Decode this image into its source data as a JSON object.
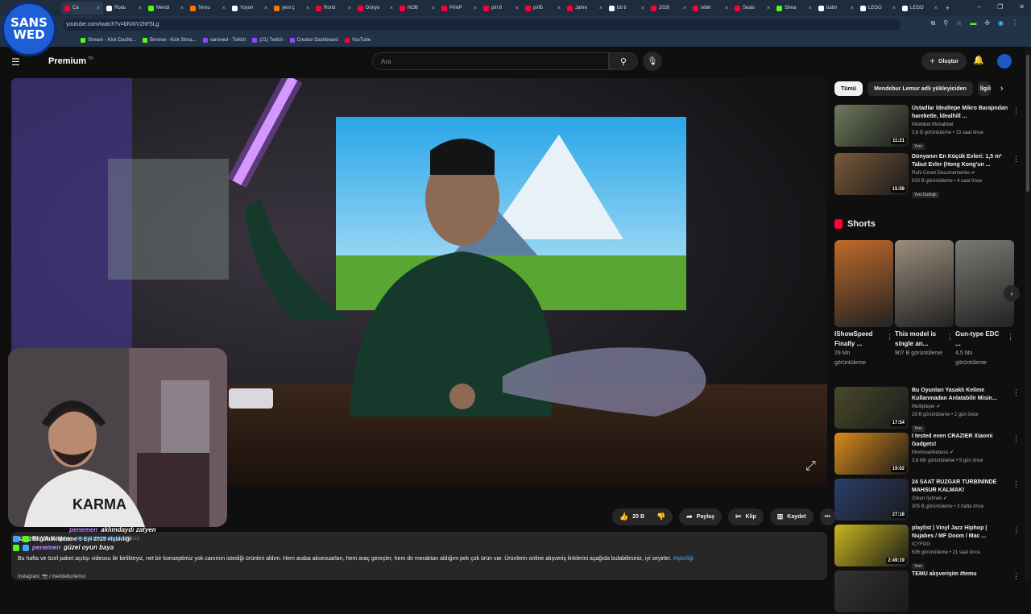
{
  "browser": {
    "tabs": [
      {
        "label": "Ca",
        "color": "#ff0033"
      },
      {
        "label": "Rodu",
        "color": "#ffffff"
      },
      {
        "label": "Mendi",
        "color": "#53fc18"
      },
      {
        "label": "Temu",
        "color": "#fb7701"
      },
      {
        "label": "Yoyon",
        "color": "#ffffff"
      },
      {
        "label": "yeni ç",
        "color": "#fb7701"
      },
      {
        "label": "Rond",
        "color": "#ff0033"
      },
      {
        "label": "Dünya",
        "color": "#ff0033"
      },
      {
        "label": "NOB",
        "color": "#ff0033"
      },
      {
        "label": "PinkP",
        "color": "#ff0033"
      },
      {
        "label": "piri 8",
        "color": "#ff0033"
      },
      {
        "label": "piriБ",
        "color": "#ff0033"
      },
      {
        "label": "Jahre",
        "color": "#ff0033"
      },
      {
        "label": "bb tr",
        "color": "#ffffff"
      },
      {
        "label": "2026",
        "color": "#ff0033"
      },
      {
        "label": "lvbel",
        "color": "#ff0033"
      },
      {
        "label": "Seals",
        "color": "#ff0033"
      },
      {
        "label": "Strea",
        "color": "#53fc18"
      },
      {
        "label": "batm",
        "color": "#ffffff"
      },
      {
        "label": "LEGO",
        "color": "#ffffff"
      },
      {
        "label": "LEGO",
        "color": "#ffffff"
      }
    ],
    "new_tab": "+",
    "window_controls": [
      "–",
      "❐",
      "✕"
    ],
    "url": "youtube.com/watch?v=bNXiV2hF5Lg",
    "bookmarks": [
      {
        "label": "Stream - Kick Dashb...",
        "color": "#53fc18"
      },
      {
        "label": "Browse - Kick Strea...",
        "color": "#53fc18"
      },
      {
        "label": "sansved - Twitch",
        "color": "#9146ff"
      },
      {
        "label": "(21) Twitch",
        "color": "#9146ff"
      },
      {
        "label": "Creator Dashboard",
        "color": "#9146ff"
      },
      {
        "label": "YouTube",
        "color": "#ff0033"
      }
    ]
  },
  "overlay_logo": {
    "line1": "SANS",
    "line2": "WED"
  },
  "header": {
    "brand": "Premium",
    "brand_suffix": "TR",
    "search_placeholder": "Ara",
    "create_label": "Oluştur"
  },
  "actions": {
    "like_count": "20 B",
    "share": "Paylaş",
    "clip": "Klip",
    "save": "Kaydet"
  },
  "description": {
    "stats": "425.293 görüntülenme  5 Eyl 2025  #işbirliği",
    "text": "Bu hafta ve özel paket açılışı videosu ile birlikteyiz, net bir konseptimiz yok canımın istediği ürünleri aldım. Hem araba aksesuarları, hem araç gereçler, hem de meraktan aldığım pek çok ürün var. Ürünlerin online alışveriş linklerini aşağıda bulabilirsiniz, iyi seyirler.",
    "hashtag": "#işbirliği",
    "instagram": "Instagram:  📷 / mendeburlemur"
  },
  "chat": [
    {
      "user": "penemen",
      "msg": "aklımdaydı zatyen",
      "color": "#b988ff"
    },
    {
      "user": "BbVA Kripto:",
      "msg": "güzel oyun baya",
      "link": "https://www.bbvakripto.com.tr/"
    },
    {
      "user": "penemen",
      "msg": "güzel oyun baya"
    }
  ],
  "sidebar": {
    "chips": [
      "Tümü",
      "Mendebur Lemur adlı yükleyiciden",
      "İlgili"
    ],
    "recs_top": [
      {
        "title": "Üstadlar İdealtepe Mikro Barajından hareketle, İdealhill ...",
        "channel": "Müebbet Muhabbet",
        "meta": "3,6 B görüntüleme • 13 saat önce",
        "badge": "Yeni",
        "duration": "11:21",
        "thumb": "#6f7a5c"
      },
      {
        "title": "Dünyanın En Küçük Evleri: 1,5 m² Tabut Evler (Hong Kong'un ...",
        "channel": "Ruhi Cenet Documentaries ✔",
        "meta": "910 B görüntüleme • 4 saat önce",
        "badge": "Yeni  Dublajlı",
        "duration": "15:59",
        "thumb": "#7a5a3a"
      }
    ],
    "shorts_title": "Shorts",
    "shorts": [
      {
        "title": "IShowSpeed Finally ...",
        "views": "29 Mn görüntüleme",
        "thumb": "#c06a2a"
      },
      {
        "title": "This model is single an...",
        "views": "907 B görüntüleme",
        "thumb": "#9a8d7c"
      },
      {
        "title": "Gun-type EDC ...",
        "views": "4,5 Mn görüntüleme",
        "thumb": "#7a7a74"
      }
    ],
    "recs_bottom": [
      {
        "title": "Bu Oyunları Yasaklı Kelime Kullanmadan Anlatabilir Misin...",
        "channel": "Multiplayer ✔",
        "meta": "29 B görüntüleme • 2 gün önce",
        "badge": "Yeni",
        "duration": "17:54",
        "thumb": "#4a4a2c"
      },
      {
        "title": "I tested even CRAZIER Xiaomi Gadgets!",
        "channel": "Mrwhosetheboss ✔",
        "meta": "3,8 Mn görüntüleme • 9 gün önce",
        "badge": "",
        "duration": "19:02",
        "thumb": "#d98b1c"
      },
      {
        "title": "24 SAAT RÜZGAR TÜRBİNİNDE MAHSUR KALMAK!",
        "channel": "Orkun Işıtmak ✔",
        "meta": "305 B görüntüleme • 3 hafta önce",
        "badge": "",
        "duration": "27:18",
        "thumb": "#2a3f6a"
      },
      {
        "title": "playlist | Vinyl Jazz Hiphop | Nujabes / MF Doom / Mac ...",
        "channel": "ICYFOG",
        "meta": "636 görüntüleme • 21 saat önce",
        "badge": "Yeni",
        "duration": "2:49:19",
        "thumb": "#c9b81c"
      },
      {
        "title": "TEMU alışverişim #temu",
        "channel": "",
        "meta": "",
        "badge": "",
        "duration": "",
        "thumb": "#333333"
      }
    ]
  }
}
